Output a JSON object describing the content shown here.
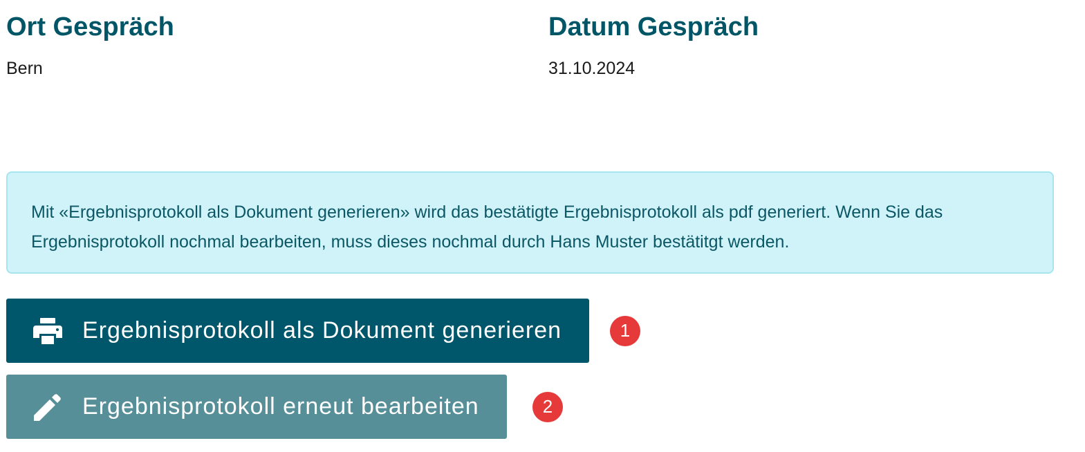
{
  "fields": {
    "ort": {
      "label": "Ort Gespräch",
      "value": "Bern"
    },
    "datum": {
      "label": "Datum Gespräch",
      "value": "31.10.2024"
    }
  },
  "info": {
    "text": "Mit «Ergebnisprotokoll als Dokument generieren» wird das bestätigte Ergebnisprotokoll als pdf generiert. Wenn Sie das Ergebnisprotokoll nochmal bearbeiten, muss dieses nochmal durch Hans Muster bestätitgt werden."
  },
  "actions": {
    "generate": {
      "label": "Ergebnisprotokoll als Dokument generieren",
      "icon": "printer-icon",
      "badge": "1"
    },
    "edit": {
      "label": "Ergebnisprotokoll erneut bearbeiten",
      "icon": "pencil-icon",
      "badge": "2"
    }
  },
  "colors": {
    "heading": "#005566",
    "primary_button": "#00566a",
    "secondary_button": "#578f99",
    "info_background": "#cff3f8",
    "info_border": "#a6e4ee",
    "badge": "#e63a3a"
  }
}
